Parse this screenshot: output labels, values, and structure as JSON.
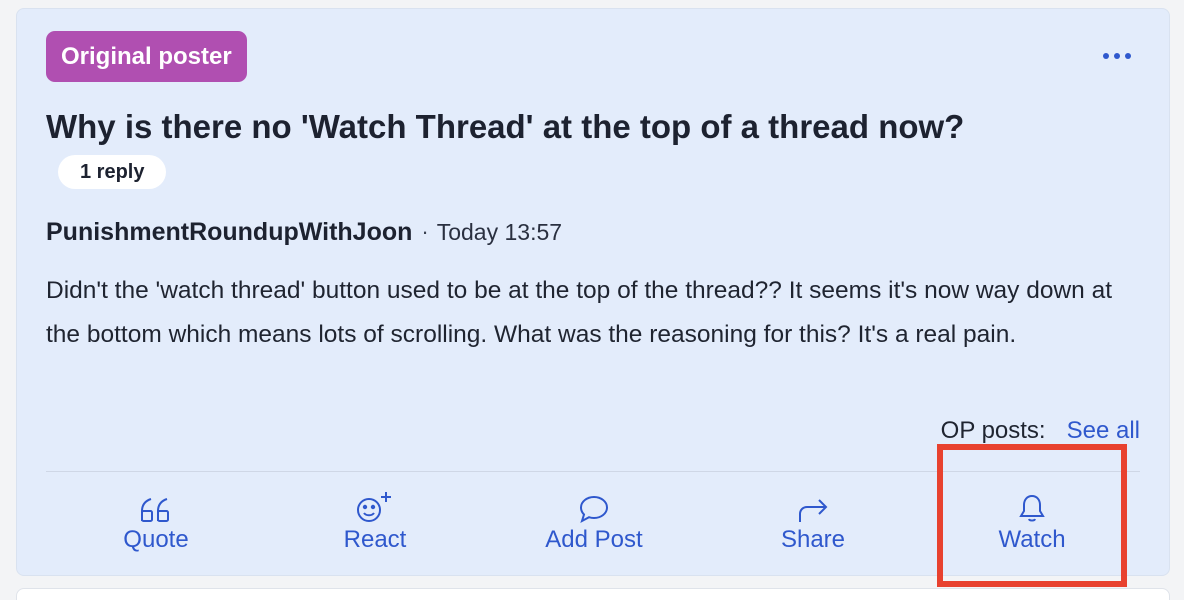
{
  "post": {
    "badge": "Original poster",
    "title": "Why is there no 'Watch Thread' at the top of a thread now?",
    "replies": "1 reply",
    "author": "PunishmentRoundupWithJoon",
    "separator": "·",
    "time": "Today 13:57",
    "body": "Didn't the 'watch thread' button used to be at the top of the thread?? It seems it's now way down at the bottom which means lots of scrolling. What was the reasoning for this? It's a real pain.",
    "op_posts_label": "OP posts:",
    "see_all": "See all"
  },
  "actions": [
    {
      "label": "Quote",
      "icon": "quote-icon"
    },
    {
      "label": "React",
      "icon": "react-icon"
    },
    {
      "label": "Add Post",
      "icon": "speech-bubble-icon"
    },
    {
      "label": "Share",
      "icon": "share-arrow-icon"
    },
    {
      "label": "Watch",
      "icon": "bell-icon"
    }
  ],
  "colors": {
    "card_background": "#e3ecfb",
    "badge": "#b04fb1",
    "link": "#2f58cd",
    "highlight": "#e8412f"
  }
}
